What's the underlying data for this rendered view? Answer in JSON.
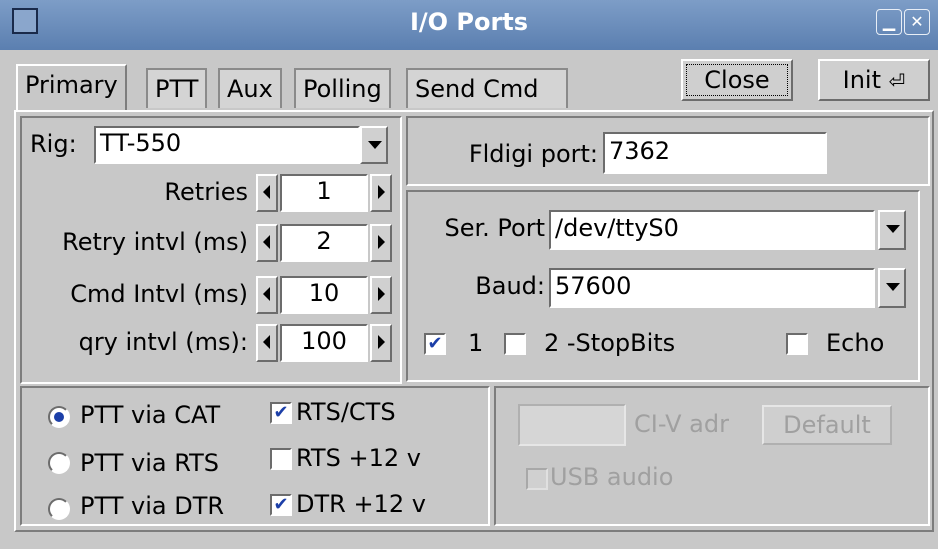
{
  "window": {
    "title": "I/O Ports",
    "minimize_icon": "minimize-icon",
    "close_icon": "close-icon"
  },
  "tabs": [
    "Primary",
    "PTT",
    "Aux",
    "Polling",
    "Send Cmd"
  ],
  "active_tab": "Primary",
  "buttons": {
    "close": "Close",
    "init": "Init",
    "init_icon": "return-arrow-icon"
  },
  "rig": {
    "label": "Rig:",
    "value": "TT-550"
  },
  "spinners": [
    {
      "label": "Retries",
      "value": "1"
    },
    {
      "label": "Retry intvl (ms)",
      "value": "2"
    },
    {
      "label": "Cmd Intvl (ms)",
      "value": "10"
    },
    {
      "label": "qry intvl (ms):",
      "value": "100"
    }
  ],
  "fldigi": {
    "label": "Fldigi port:",
    "value": "7362"
  },
  "serial": {
    "port_label": "Ser. Port",
    "port_value": "/dev/ttyS0",
    "baud_label": "Baud:",
    "baud_value": "57600",
    "stopbit1_label": "1",
    "stopbit1_checked": true,
    "stopbit2_label": "2 -StopBits",
    "stopbit2_checked": false,
    "echo_label": "Echo",
    "echo_checked": false
  },
  "ptt": {
    "options": [
      {
        "label": "PTT via CAT",
        "selected": true
      },
      {
        "label": "PTT via RTS",
        "selected": false
      },
      {
        "label": "PTT via DTR",
        "selected": false
      }
    ],
    "checks": [
      {
        "label": "RTS/CTS",
        "checked": true
      },
      {
        "label": "RTS +12 v",
        "checked": false
      },
      {
        "label": "DTR +12 v",
        "checked": true
      }
    ]
  },
  "civ": {
    "label": "CI-V adr",
    "default_button": "Default",
    "usb_audio_label": "USB audio"
  },
  "colors": {
    "titlebar": "#6a8cbc",
    "face": "#c8c8c8",
    "check": "#1c3fa8"
  }
}
